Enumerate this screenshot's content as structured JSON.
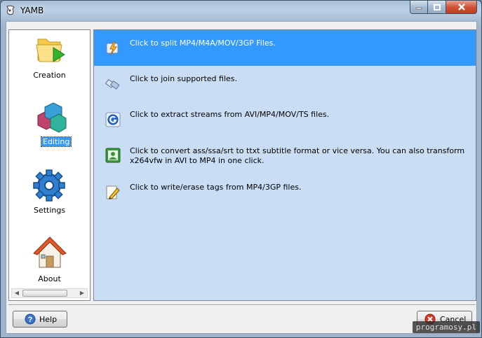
{
  "window": {
    "title": "YAMB"
  },
  "sidebar": {
    "items": [
      {
        "label": "Creation",
        "icon": "folder-play-icon",
        "selected": false
      },
      {
        "label": "Editing",
        "icon": "cubes-icon",
        "selected": true
      },
      {
        "label": "Settings",
        "icon": "gear-icon",
        "selected": false
      },
      {
        "label": "About",
        "icon": "house-icon",
        "selected": false
      }
    ]
  },
  "tasks": [
    {
      "text": "Click to split MP4/M4A/MOV/3GP Files.",
      "icon": "split-icon",
      "selected": true
    },
    {
      "text": "Click to join supported files.",
      "icon": "join-icon",
      "selected": false
    },
    {
      "text": "Click to extract streams from AVI/MP4/MOV/TS files.",
      "icon": "extract-icon",
      "selected": false
    },
    {
      "text": "Click to convert ass/ssa/srt to ttxt subtitle format or vice versa. You can also transform x264vfw in AVI to MP4 in one click.",
      "icon": "subtitle-icon",
      "selected": false
    },
    {
      "text": "Click to write/erase tags from MP4/3GP files.",
      "icon": "tag-edit-icon",
      "selected": false
    }
  ],
  "buttons": {
    "help": "Help",
    "cancel": "Cancel"
  },
  "watermark": "programosy.pl",
  "colors": {
    "selection": "#3399ff",
    "task_panel_bg": "#c9def5"
  }
}
